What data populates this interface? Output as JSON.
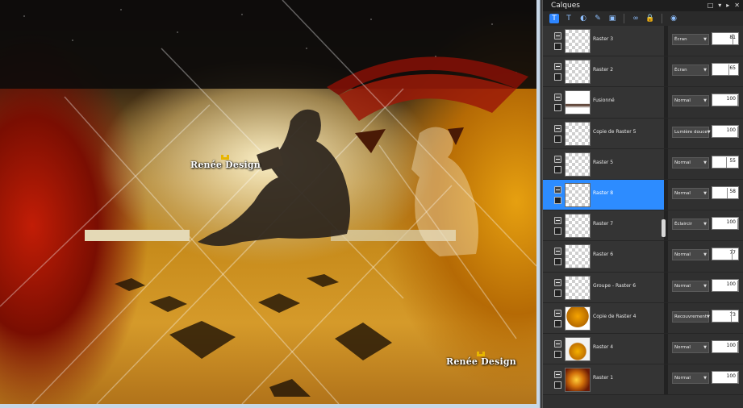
{
  "panel": {
    "title": "Calques",
    "header_controls": [
      "□",
      "▾",
      "▸",
      "✕"
    ],
    "toolbar_icons": [
      "new-raster-layer-icon",
      "new-vector-layer-icon",
      "new-mask-layer-icon",
      "adjustment-layer-icon",
      "new-group-icon",
      "link-icon",
      "lock-icon",
      "layer-properties-icon"
    ]
  },
  "watermarks": [
    "Renée Design",
    "Renée Design"
  ],
  "layers": [
    {
      "name": "Raster 3",
      "blend": "Écran",
      "opacity": "81",
      "thumb": "transparent",
      "selected": false
    },
    {
      "name": "Raster 2",
      "blend": "Écran",
      "opacity": "65",
      "thumb": "transparent",
      "selected": false
    },
    {
      "name": "Fusionné",
      "blend": "Normal",
      "opacity": "100",
      "thumb": "merged",
      "selected": false
    },
    {
      "name": "Copie de Raster 5",
      "blend": "Lumière douce",
      "opacity": "100",
      "thumb": "transparent",
      "selected": false
    },
    {
      "name": "Raster 5",
      "blend": "Normal",
      "opacity": "55",
      "thumb": "transparent",
      "selected": false
    },
    {
      "name": "Raster 8",
      "blend": "Normal",
      "opacity": "58",
      "thumb": "transparent",
      "selected": true
    },
    {
      "name": "Raster 7",
      "blend": "Éclaircir",
      "opacity": "100",
      "thumb": "transparent",
      "selected": false
    },
    {
      "name": "Raster 6",
      "blend": "Normal",
      "opacity": "77",
      "thumb": "transparent",
      "selected": false
    },
    {
      "name": "Groupe - Raster 6",
      "blend": "Normal",
      "opacity": "100",
      "thumb": "transparent",
      "selected": false
    },
    {
      "name": "Copie de Raster 4",
      "blend": "Recouvrement",
      "opacity": "73",
      "thumb": "copy4",
      "selected": false
    },
    {
      "name": "Raster 4",
      "blend": "Normal",
      "opacity": "100",
      "thumb": "r4",
      "selected": false
    },
    {
      "name": "Raster 1",
      "blend": "Normal",
      "opacity": "100",
      "thumb": "r1",
      "selected": false
    }
  ],
  "colors": {
    "selected": "#2d8cff",
    "panel_bg": "#303030",
    "accent_gold": "#e8b600"
  }
}
